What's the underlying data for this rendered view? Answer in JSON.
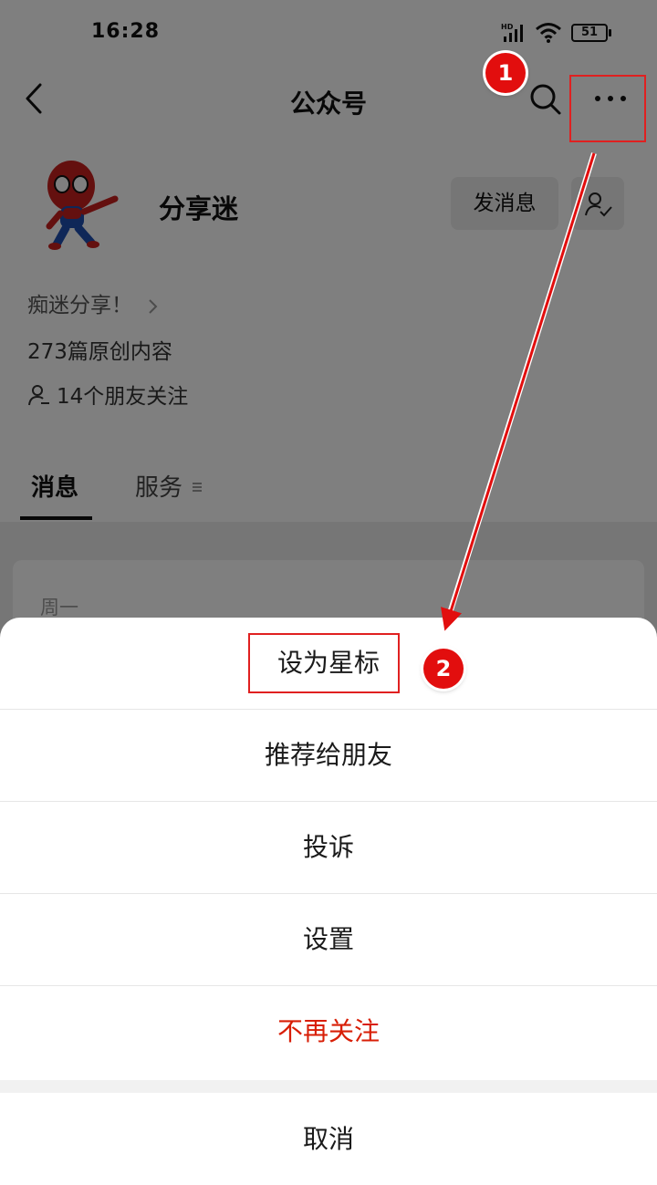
{
  "status_bar": {
    "time": "16:28",
    "battery": "51",
    "signal_label": "HD"
  },
  "nav": {
    "title": "公众号"
  },
  "account": {
    "name": "分享迷",
    "message_button": "发消息",
    "description": "痴迷分享！",
    "original_count": "273篇原创内容",
    "friends_following": "14个朋友关注"
  },
  "tabs": [
    {
      "label": "消息"
    },
    {
      "label": "服务"
    }
  ],
  "feed": {
    "date": "周一"
  },
  "action_sheet": {
    "items": [
      {
        "label": "设为星标"
      },
      {
        "label": "推荐给朋友"
      },
      {
        "label": "投诉"
      },
      {
        "label": "设置"
      },
      {
        "label": "不再关注"
      }
    ],
    "cancel": "取消"
  },
  "annotations": {
    "step1": "1",
    "step2": "2"
  },
  "colors": {
    "danger": "#d81e06",
    "annotation_red": "#e02020",
    "overlay": "rgba(0,0,0,0.5)"
  }
}
